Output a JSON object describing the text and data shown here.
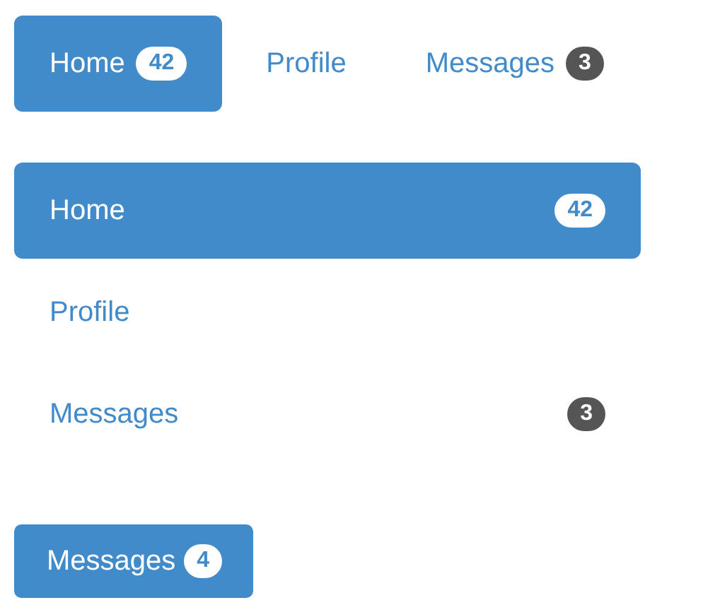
{
  "nav_pills": [
    {
      "label": "Home",
      "badge": "42",
      "selected": true
    },
    {
      "label": "Profile",
      "selected": false
    },
    {
      "label": "Messages",
      "badge": "3",
      "selected": false
    }
  ],
  "stacked_pills": [
    {
      "label": "Home",
      "badge": "42",
      "selected": true
    },
    {
      "label": "Profile",
      "selected": false
    },
    {
      "label": "Messages",
      "badge": "3",
      "selected": false
    }
  ],
  "button": {
    "label": "Messages",
    "badge": "4"
  }
}
